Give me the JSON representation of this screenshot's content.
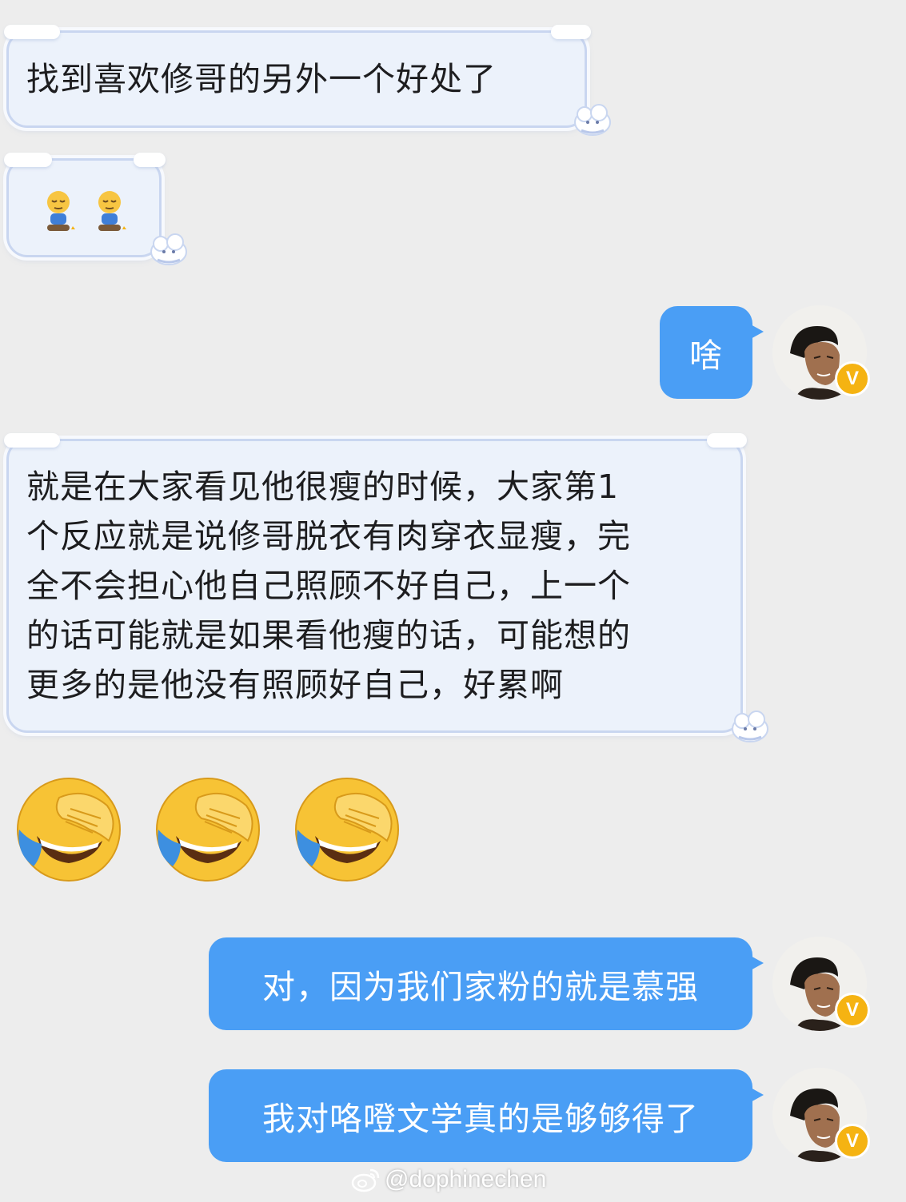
{
  "chat": {
    "messages": [
      {
        "side": "left",
        "text": "找到喜欢修哥的另外一个好处了"
      },
      {
        "side": "left",
        "text": "",
        "icons": [
          "sleepy-sitting-person-icon",
          "sleepy-sitting-person-icon"
        ]
      },
      {
        "side": "right",
        "text": "啥"
      },
      {
        "side": "left",
        "lines": [
          "就是在大家看见他很瘦的时候，大家第1",
          "个反应就是说修哥脱衣有肉穿衣显瘦，完",
          "全不会担心他自己照顾不好自己，上一个",
          "的话可能就是如果看他瘦的话，可能想的",
          "更多的是他没有照顾好自己，好累啊"
        ]
      },
      {
        "side": "left",
        "text": "",
        "icons": [
          "laughing-facepalm-icon",
          "laughing-facepalm-icon",
          "laughing-facepalm-icon"
        ]
      },
      {
        "side": "right",
        "text": "对，因为我们家粉的就是慕强"
      },
      {
        "side": "right",
        "text": "我对咯噔文学真的是够够得了"
      }
    ]
  },
  "avatar": {
    "badge": "V"
  },
  "watermark": {
    "text": "@dophinechen"
  },
  "colors": {
    "background": "#ededed",
    "outgoing_bubble": "#4a9ef5",
    "incoming_bubble": "#ecf2fb",
    "incoming_border": "#c9d6f0",
    "badge": "#f5b312"
  }
}
